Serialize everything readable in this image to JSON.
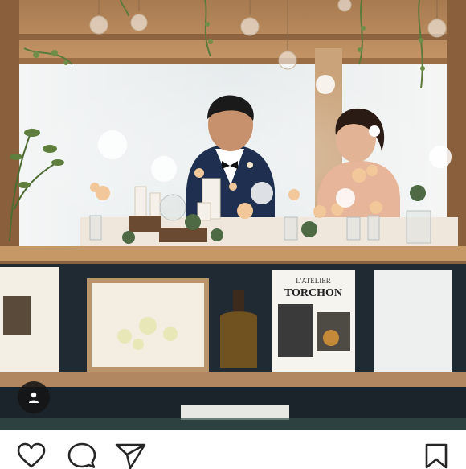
{
  "post": {
    "image": {
      "description_icon": "wedding-photo",
      "book_cover_title_1": "L'ATELIER",
      "book_cover_title_2": "TORCHON"
    },
    "user_tag": {
      "icon": "person-icon"
    }
  },
  "actions": {
    "like": {
      "icon": "heart-icon"
    },
    "comment": {
      "icon": "comment-icon"
    },
    "share": {
      "icon": "paper-plane-icon"
    },
    "save": {
      "icon": "bookmark-icon"
    }
  },
  "colors": {
    "wood": "#b9895c",
    "wall": "#1f2a33",
    "window": "#eef1f2",
    "icon": "#262626"
  }
}
